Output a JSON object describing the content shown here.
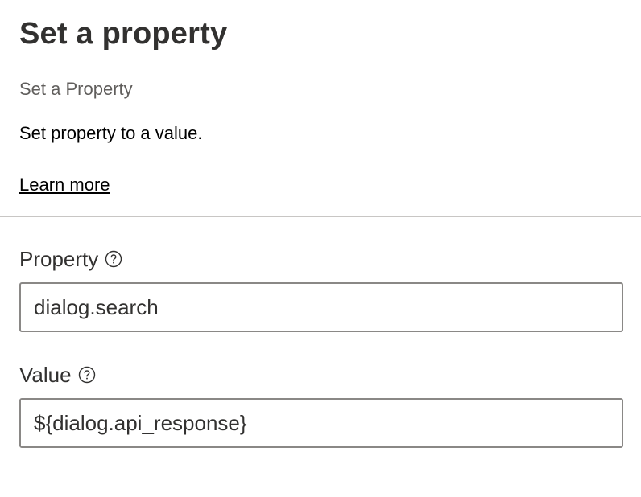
{
  "header": {
    "title": "Set a property",
    "subtitle": "Set a Property",
    "description": "Set property to a value.",
    "learn_more": "Learn more"
  },
  "fields": {
    "property": {
      "label": "Property",
      "value": "dialog.search",
      "help_icon": "question-circle-icon"
    },
    "value": {
      "label": "Value",
      "value": "${dialog.api_response}",
      "help_icon": "question-circle-icon"
    }
  },
  "colors": {
    "title": "#323130",
    "subtitle": "#605e5c",
    "divider": "#c8c6c4",
    "input_border": "#8a8886"
  }
}
